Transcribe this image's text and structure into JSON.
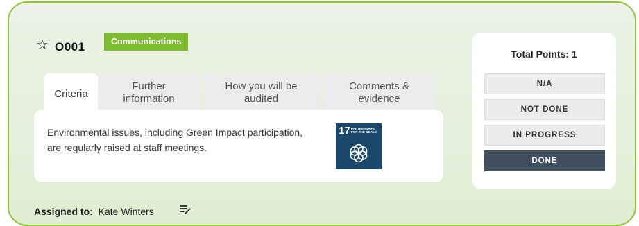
{
  "item": {
    "code": "O001",
    "category": "Communications",
    "criteria_text": "Environmental issues, including Green Impact participation, are regularly raised at staff meetings."
  },
  "tabs": [
    {
      "label": "Criteria"
    },
    {
      "label_line1": "Further",
      "label_line2": "information"
    },
    {
      "label_line1": "How you will be",
      "label_line2": "audited"
    },
    {
      "label_line1": "Comments &",
      "label_line2": "evidence"
    }
  ],
  "sdg_badge": {
    "number": "17",
    "title": "PARTNERSHIPS FOR THE GOALS",
    "color": "#19486a"
  },
  "points": {
    "total_label": "Total Points: 1",
    "statuses": [
      "N/A",
      "NOT DONE",
      "IN PROGRESS",
      "DONE"
    ],
    "selected": "DONE"
  },
  "assigned": {
    "label": "Assigned to:",
    "name": "Kate Winters"
  },
  "icons": {
    "favorite": "star-outline-icon",
    "edit": "edit-list-icon"
  },
  "colors": {
    "accent_green": "#7dbb2f",
    "card_border": "#8fc33a",
    "selected_status": "#3f4f5e"
  }
}
